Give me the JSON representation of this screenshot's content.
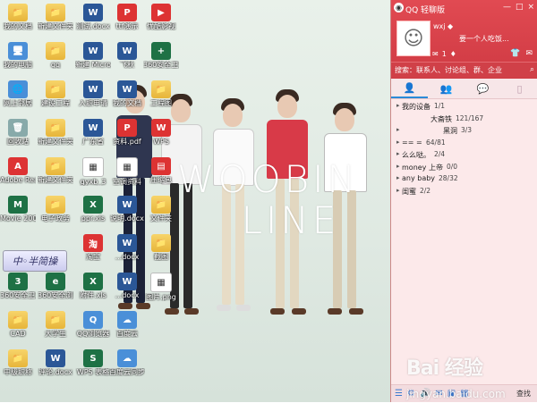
{
  "desktop": {
    "brand_line1": "WOOBIN",
    "brand_line2": "LINE",
    "ime_label": "中◦半简操",
    "watermark_main": "Bai  经验",
    "watermark_sub": "jingyan.baidu.com",
    "icons": [
      {
        "label": "我的文档",
        "glyph": "📁",
        "kind": "folder"
      },
      {
        "label": "我的电脑",
        "glyph": "🖥",
        "kind": "pc"
      },
      {
        "label": "网上邻居",
        "glyph": "🌐",
        "kind": "pc"
      },
      {
        "label": "回收站",
        "glyph": "🗑",
        "kind": "trash"
      },
      {
        "label": "Adobe Reader XI",
        "glyph": "A",
        "kind": "red"
      },
      {
        "label": "Movie 2008",
        "glyph": "M",
        "kind": "excel"
      },
      {
        "label": "",
        "glyph": "",
        "kind": "none"
      },
      {
        "label": "360安全卫士",
        "glyph": "3",
        "kind": "excel"
      },
      {
        "label": "CAD",
        "glyph": "📁",
        "kind": "folder"
      },
      {
        "label": "中级职称",
        "glyph": "📁",
        "kind": "folder"
      },
      {
        "label": "新建文件夹",
        "glyph": "📁",
        "kind": "folder"
      },
      {
        "label": "qq",
        "glyph": "📁",
        "kind": "folder"
      },
      {
        "label": "建设工程",
        "glyph": "📁",
        "kind": "folder"
      },
      {
        "label": "新建文件夹",
        "glyph": "📁",
        "kind": "folder"
      },
      {
        "label": "新建文件夹",
        "glyph": "📁",
        "kind": "folder"
      },
      {
        "label": "电子政务",
        "glyph": "📁",
        "kind": "folder"
      },
      {
        "label": "",
        "glyph": "",
        "kind": "none"
      },
      {
        "label": "360安全浏览器",
        "glyph": "e",
        "kind": "excel"
      },
      {
        "label": "大学生",
        "glyph": "📁",
        "kind": "folder"
      },
      {
        "label": "评论.docx",
        "glyph": "W",
        "kind": "word"
      },
      {
        "label": "测试.docx",
        "glyph": "W",
        "kind": "word"
      },
      {
        "label": "新建 Microsoft",
        "glyph": "W",
        "kind": "word"
      },
      {
        "label": "入职申请",
        "glyph": "W",
        "kind": "word"
      },
      {
        "label": "广东省",
        "glyph": "W",
        "kind": "word"
      },
      {
        "label": "gyxb_3",
        "glyph": "▦",
        "kind": "white"
      },
      {
        "label": "ppr.xls",
        "glyph": "X",
        "kind": "excel"
      },
      {
        "label": "淘宝",
        "glyph": "淘",
        "kind": "red"
      },
      {
        "label": "附件.xls",
        "glyph": "X",
        "kind": "excel"
      },
      {
        "label": "QQ浏览器",
        "glyph": "Q",
        "kind": "pc"
      },
      {
        "label": "WPS 表格",
        "glyph": "S",
        "kind": "excel"
      },
      {
        "label": "ttf演示",
        "glyph": "P",
        "kind": "red"
      },
      {
        "label": "飞秋",
        "glyph": "W",
        "kind": "word"
      },
      {
        "label": "我的文档",
        "glyph": "W",
        "kind": "word"
      },
      {
        "label": "资料.pdf",
        "glyph": "P",
        "kind": "red"
      },
      {
        "label": "空调资料",
        "glyph": "▦",
        "kind": "white"
      },
      {
        "label": "说明.docx",
        "glyph": "W",
        "kind": "word"
      },
      {
        "label": "...docx",
        "glyph": "W",
        "kind": "word"
      },
      {
        "label": "...docx",
        "glyph": "W",
        "kind": "word"
      },
      {
        "label": "百度云",
        "glyph": "☁",
        "kind": "pc"
      },
      {
        "label": "百度云同步",
        "glyph": "☁",
        "kind": "pc"
      },
      {
        "label": "优酷影视",
        "glyph": "▶",
        "kind": "red"
      },
      {
        "label": "360安全卫士",
        "glyph": "+",
        "kind": "excel"
      },
      {
        "label": "工程图",
        "glyph": "📁",
        "kind": "folder"
      },
      {
        "label": "WPS",
        "glyph": "W",
        "kind": "red"
      },
      {
        "label": "压缩包",
        "glyph": "▤",
        "kind": "red"
      },
      {
        "label": "文件夹",
        "glyph": "📁",
        "kind": "folder"
      },
      {
        "label": "截图",
        "glyph": "📁",
        "kind": "folder"
      },
      {
        "label": "图片.png",
        "glyph": "▦",
        "kind": "white"
      }
    ]
  },
  "qq": {
    "title": "QQ 轻聊版",
    "controls": [
      "—",
      "□",
      "×"
    ],
    "nickname": "wxj ◆",
    "signature": "要一个人吃饭...",
    "status_icons": [
      "✉",
      "1",
      "♦"
    ],
    "right_icons": [
      "👕",
      "✉"
    ],
    "search_placeholder": "搜索：联系人、讨论组、群、企业",
    "search_icon": "⌕",
    "tabs": [
      "👤",
      "👥",
      "💬",
      "▯"
    ],
    "groups": [
      {
        "arrow": "▸",
        "name": "我的设备",
        "count": "1/1",
        "indent": 0
      },
      {
        "arrow": "",
        "name": "大斋铁",
        "count": "121/167",
        "indent": 1
      },
      {
        "arrow": "▸",
        "name": "黑洞",
        "count": "3/3",
        "indent": 2
      },
      {
        "arrow": "▸",
        "name": "== =",
        "count": "64/81",
        "indent": 0
      },
      {
        "arrow": "▸",
        "name": "么么哒。",
        "count": "2/4",
        "indent": 0
      },
      {
        "arrow": "▸",
        "name": "money 上帝",
        "count": "0/0",
        "indent": 0
      },
      {
        "arrow": "▸",
        "name": "any baby",
        "count": "28/32",
        "indent": 0
      },
      {
        "arrow": "▸",
        "name": "闺蜜",
        "count": "2/2",
        "indent": 0
      }
    ],
    "bottom_icons": [
      "☰",
      "⚙",
      "🔊",
      "✉",
      "▣",
      "▦"
    ],
    "find_label": "查找"
  }
}
